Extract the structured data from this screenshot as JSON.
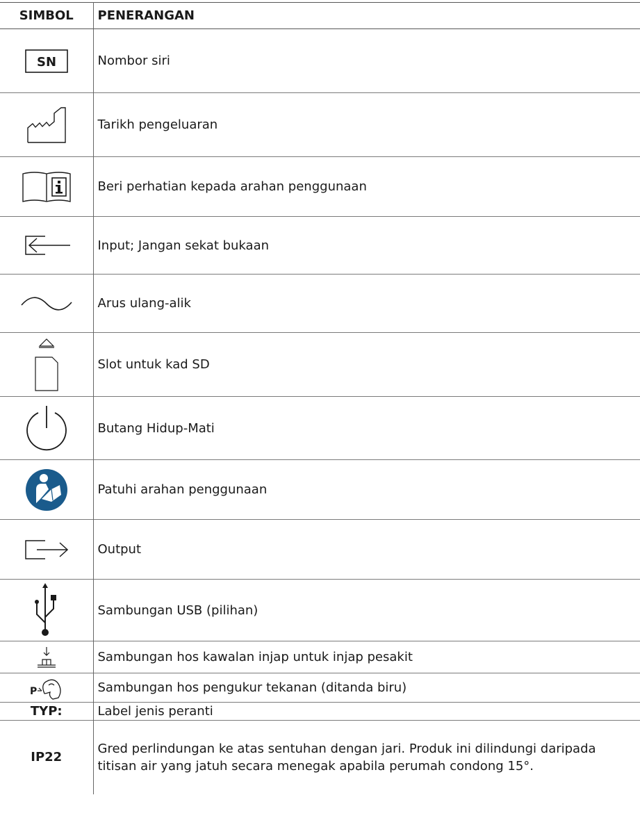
{
  "header": {
    "col_symbol": "SIMBOL",
    "col_description": "PENERANGAN"
  },
  "rows": [
    {
      "icon": "serial-number-icon",
      "symbol_text": "SN",
      "description": "Nombor siri"
    },
    {
      "icon": "date-of-manufacture-icon",
      "description": "Tarikh pengeluaran"
    },
    {
      "icon": "consult-instructions-icon",
      "description": "Beri perhatian kepada arahan penggunaan"
    },
    {
      "icon": "input-icon",
      "description": "Input; Jangan sekat bukaan"
    },
    {
      "icon": "alternating-current-icon",
      "description": "Arus ulang-alik"
    },
    {
      "icon": "sd-card-slot-icon",
      "description": "Slot untuk kad SD"
    },
    {
      "icon": "power-button-icon",
      "description": "Butang Hidup-Mati"
    },
    {
      "icon": "follow-instructions-icon",
      "description": "Patuhi arahan penggunaan",
      "color": "#1a5b8c"
    },
    {
      "icon": "output-icon",
      "description": "Output"
    },
    {
      "icon": "usb-icon",
      "description": "Sambungan USB (pilihan)"
    },
    {
      "icon": "valve-control-hose-icon",
      "description": "Sambungan hos kawalan injap untuk injap pesakit"
    },
    {
      "icon": "pressure-hose-icon",
      "symbol_text": "P",
      "description": "Sambungan hos pengukur tekanan (ditanda biru)"
    },
    {
      "icon": "none",
      "symbol_text": "TYP:",
      "description": "Label jenis peranti"
    },
    {
      "icon": "none",
      "symbol_text": "IP22",
      "description": "Gred perlindungan ke atas sentuhan dengan jari. Produk ini dilindungi daripada titisan air yang jatuh secara menegak apabila perumah condong 15°."
    }
  ]
}
